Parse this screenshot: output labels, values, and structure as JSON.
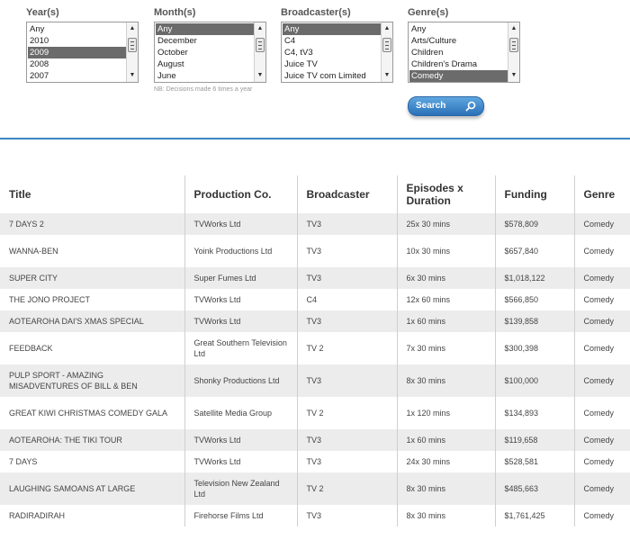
{
  "filters": {
    "year": {
      "label": "Year(s)",
      "options": [
        "Any",
        "2010",
        "2009",
        "2008",
        "2007"
      ],
      "selected": "2009"
    },
    "month": {
      "label": "Month(s)",
      "options": [
        "Any",
        "December",
        "October",
        "August",
        "June"
      ],
      "selected": "Any"
    },
    "broadcaster": {
      "label": "Broadcaster(s)",
      "options": [
        "Any",
        "C4",
        "C4, tV3",
        "Juice TV",
        "Juice TV com Limited"
      ],
      "selected": "Any"
    },
    "genre": {
      "label": "Genre(s)",
      "options": [
        "Any",
        "Arts/Culture",
        "Children",
        "Children's Drama",
        "Comedy"
      ],
      "selected": "Comedy"
    }
  },
  "note": "NB: Decisions made 6 times a year",
  "search_label": "Search",
  "accent_color": "#3a86c6",
  "table": {
    "headers": [
      "Title",
      "Production Co.",
      "Broadcaster",
      "Episodes x Duration",
      "Funding",
      "Genre"
    ],
    "rows": [
      [
        "7 DAYS 2",
        "TVWorks Ltd",
        "TV3",
        "25x 30 mins",
        "$578,809",
        "Comedy"
      ],
      [
        "WANNA-BEN",
        "Yoink Productions Ltd",
        "TV3",
        "10x 30 mins",
        "$657,840",
        "Comedy"
      ],
      [
        "SUPER CITY",
        "Super Fumes Ltd",
        "TV3",
        "6x 30 mins",
        "$1,018,122",
        "Comedy"
      ],
      [
        "THE JONO PROJECT",
        "TVWorks Ltd",
        "C4",
        "12x 60 mins",
        "$566,850",
        "Comedy"
      ],
      [
        "AOTEAROHA DAI'S XMAS SPECIAL",
        "TVWorks Ltd",
        "TV3",
        "1x 60 mins",
        "$139,858",
        "Comedy"
      ],
      [
        "FEEDBACK",
        "Great Southern Television Ltd",
        "TV 2",
        "7x 30 mins",
        "$300,398",
        "Comedy"
      ],
      [
        "PULP SPORT - AMAZING MISADVENTURES OF BILL & BEN",
        "Shonky Productions Ltd",
        "TV3",
        "8x 30 mins",
        "$100,000",
        "Comedy"
      ],
      [
        "GREAT KIWI CHRISTMAS COMEDY GALA",
        "Satellite Media Group",
        "TV 2",
        "1x 120 mins",
        "$134,893",
        "Comedy"
      ],
      [
        "AOTEAROHA: THE TIKI TOUR",
        "TVWorks Ltd",
        "TV3",
        "1x 60 mins",
        "$119,658",
        "Comedy"
      ],
      [
        "7 DAYS",
        "TVWorks Ltd",
        "TV3",
        "24x 30 mins",
        "$528,581",
        "Comedy"
      ],
      [
        "LAUGHING SAMOANS AT LARGE",
        "Television New Zealand Ltd",
        "TV 2",
        "8x 30 mins",
        "$485,663",
        "Comedy"
      ],
      [
        "RADIRADIRAH",
        "Firehorse Films Ltd",
        "TV3",
        "8x 30 mins",
        "$1,761,425",
        "Comedy"
      ]
    ]
  }
}
